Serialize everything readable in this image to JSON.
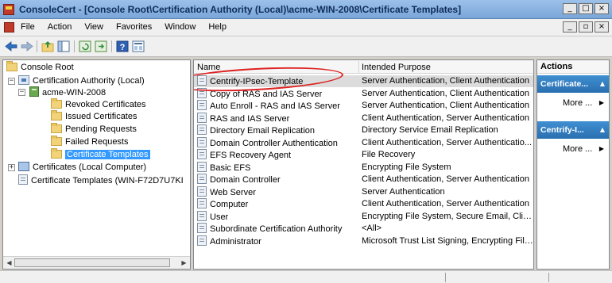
{
  "window": {
    "title": "ConsoleCert - [Console Root\\Certification Authority (Local)\\acme-WIN-2008\\Certificate Templates]",
    "minimize": "_",
    "maximize": "□",
    "close": "×"
  },
  "menubar": {
    "items": [
      "File",
      "Action",
      "View",
      "Favorites",
      "Window",
      "Help"
    ],
    "child_minimize": "_",
    "child_restore": "▫",
    "child_close": "×"
  },
  "toolbar": {
    "icons": [
      "back-icon",
      "forward-icon",
      "up-folder-icon",
      "show-hide-tree-icon",
      "refresh-icon",
      "export-list-icon",
      "help-icon",
      "properties-icon"
    ]
  },
  "tree": {
    "items": [
      {
        "label": "Console Root",
        "icon": "folder-icon"
      },
      {
        "label": "Certification Authority (Local)",
        "icon": "ca-icon",
        "expander": "−"
      },
      {
        "label": "acme-WIN-2008",
        "icon": "server-icon",
        "expander": "−"
      },
      {
        "label": "Revoked Certificates",
        "icon": "folder-icon"
      },
      {
        "label": "Issued Certificates",
        "icon": "folder-icon"
      },
      {
        "label": "Pending Requests",
        "icon": "folder-icon"
      },
      {
        "label": "Failed Requests",
        "icon": "folder-icon"
      },
      {
        "label": "Certificate Templates",
        "icon": "folder-icon",
        "selected": true
      },
      {
        "label": "Certificates (Local Computer)",
        "icon": "computer-icon",
        "expander": "+"
      },
      {
        "label": "Certificate Templates (WIN-F72D7U7KI",
        "icon": "template-icon"
      }
    ],
    "scroll_left": "◀",
    "scroll_right": "▶"
  },
  "list": {
    "columns": [
      "Name",
      "Intended Purpose"
    ],
    "rows": [
      {
        "name": "Centrify-IPsec-Template",
        "purpose": "Server Authentication, Client Authentication",
        "selected": true
      },
      {
        "name": "Copy of RAS and IAS Server",
        "purpose": "Server Authentication, Client Authentication"
      },
      {
        "name": "Auto Enroll - RAS and IAS Server",
        "purpose": "Server Authentication, Client Authentication"
      },
      {
        "name": "RAS and IAS Server",
        "purpose": "Client Authentication, Server Authentication"
      },
      {
        "name": "Directory Email Replication",
        "purpose": "Directory Service Email Replication"
      },
      {
        "name": "Domain Controller Authentication",
        "purpose": "Client Authentication, Server Authenticatio..."
      },
      {
        "name": "EFS Recovery Agent",
        "purpose": "File Recovery"
      },
      {
        "name": "Basic EFS",
        "purpose": "Encrypting File System"
      },
      {
        "name": "Domain Controller",
        "purpose": "Client Authentication, Server Authentication"
      },
      {
        "name": "Web Server",
        "purpose": "Server Authentication"
      },
      {
        "name": "Computer",
        "purpose": "Client Authentication, Server Authentication"
      },
      {
        "name": "User",
        "purpose": "Encrypting File System, Secure Email, Clien..."
      },
      {
        "name": "Subordinate Certification Authority",
        "purpose": "<All>"
      },
      {
        "name": "Administrator",
        "purpose": "Microsoft Trust List Signing, Encrypting File..."
      }
    ]
  },
  "actions": {
    "title": "Actions",
    "groups": [
      {
        "label": "Certificate...",
        "caret": "▲",
        "more": "More ...",
        "more_arrow": "▶"
      },
      {
        "label": "Centrify-I...",
        "caret": "▲",
        "more": "More ...",
        "more_arrow": "▶"
      }
    ]
  },
  "colors": {
    "selection": "#3399ff",
    "action_header": "#2a6fb0",
    "annotation_ellipse": "#dd2222"
  }
}
